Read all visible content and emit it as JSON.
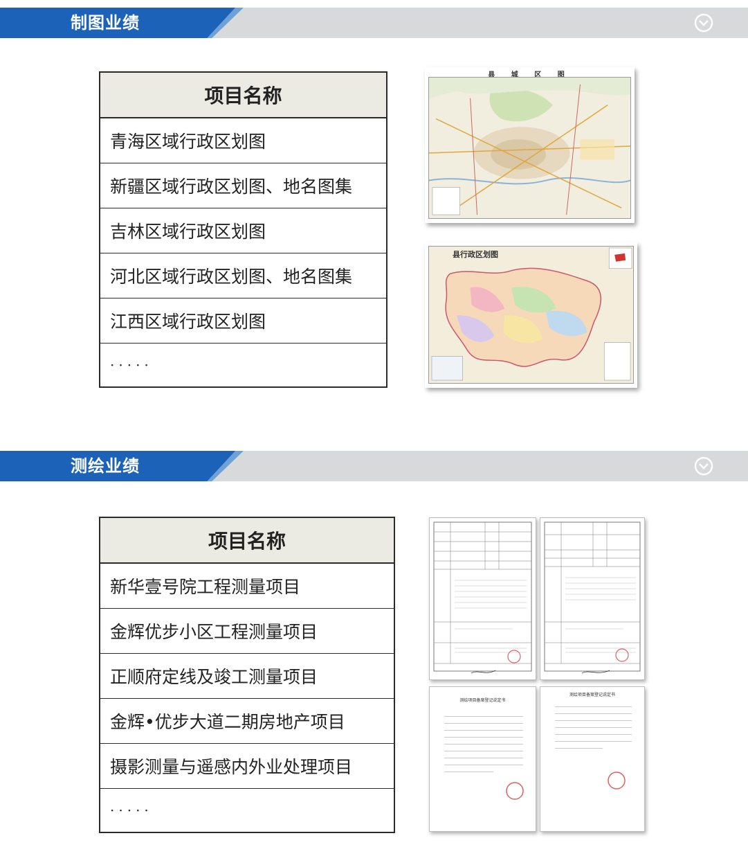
{
  "colors": {
    "banner_blue": "#1b62b8",
    "banner_gray": "#d8d9da",
    "table_header": "#ecebe3"
  },
  "sections": [
    {
      "title": "制图业绩",
      "toggle_icon": "chevron-down-circle-icon",
      "table_header": "项目名称",
      "rows": [
        "青海区域行政区划图",
        "新疆区域行政区划图、地名图集",
        "吉林区域行政区划图",
        "河北区域行政区划图、地名图集",
        "江西区域行政区划图",
        "·····"
      ]
    },
    {
      "title": "测绘业绩",
      "toggle_icon": "chevron-down-circle-icon",
      "table_header": "项目名称",
      "rows": [
        "新华壹号院工程测量项目",
        "金辉优步小区工程测量项目",
        "正顺府定线及竣工测量项目",
        "金辉•优步大道二期房地产项目",
        "摄影测量与遥感内外业处理项目",
        "·····"
      ]
    }
  ],
  "images": {
    "map1_title": "县 城 区 图",
    "map2_title": "县行政区划图",
    "doc_title": "测绘项目备案登记说定书"
  }
}
